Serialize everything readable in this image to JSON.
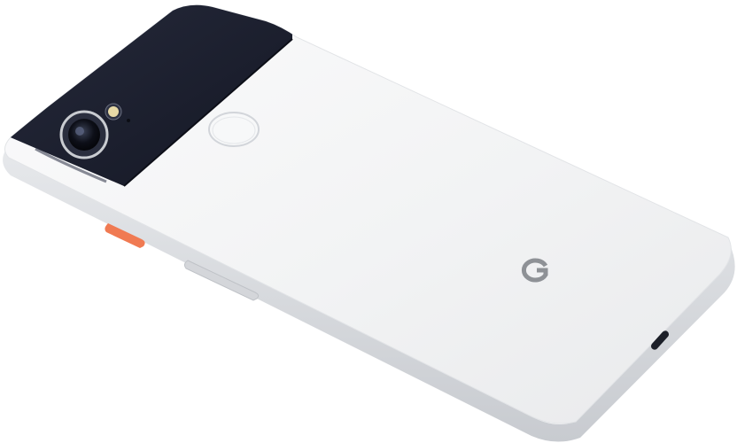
{
  "scene": {
    "subject": "smartphone-back",
    "colors": {
      "background": "#ffffff",
      "body_white": "#f3f4f5",
      "body_highlight": "#fbfbfc",
      "frame_side": "#dfe1e4",
      "frame_shadow": "#c7cacf",
      "glass_dark": "#1a1d2b",
      "glass_dark_edge": "#0d0f18",
      "power_button": "#f07a52",
      "volume_button": "#d4d6da",
      "logo": "#8e9196",
      "lens_ring": "#c9ccd1"
    },
    "icons": {
      "camera": "camera-lens-icon",
      "flash": "flash-icon",
      "fingerprint": "fingerprint-sensor-icon",
      "logo": "google-g-logo",
      "port": "usb-c-port-icon"
    }
  }
}
